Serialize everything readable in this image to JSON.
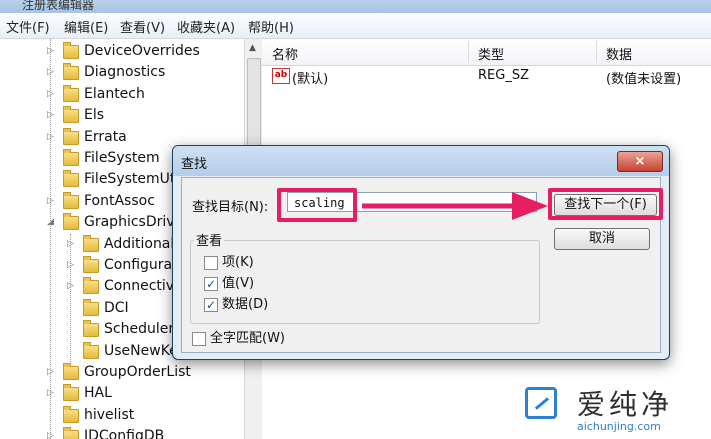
{
  "window": {
    "title": "注册表编辑器"
  },
  "menu": [
    "文件(F)",
    "编辑(E)",
    "查看(V)",
    "收藏夹(A)",
    "帮助(H)"
  ],
  "tree": {
    "items": [
      {
        "label": "DeviceOverrides",
        "level": 1
      },
      {
        "label": "Diagnostics",
        "level": 1
      },
      {
        "label": "Elantech",
        "level": 1
      },
      {
        "label": "Els",
        "level": 1
      },
      {
        "label": "Errata",
        "level": 1
      },
      {
        "label": "FileSystem",
        "level": 1
      },
      {
        "label": "FileSystemUti",
        "level": 1
      },
      {
        "label": "FontAssoc",
        "level": 1
      },
      {
        "label": "GraphicsDrive",
        "level": 1,
        "expanded": true
      },
      {
        "label": "Additional",
        "level": 2
      },
      {
        "label": "Configurat",
        "level": 2,
        "selected": true
      },
      {
        "label": "Connectiv",
        "level": 2
      },
      {
        "label": "DCI",
        "level": 2
      },
      {
        "label": "Scheduler",
        "level": 2
      },
      {
        "label": "UseNewKe",
        "level": 2
      },
      {
        "label": "GroupOrderList",
        "level": 1
      },
      {
        "label": "HAL",
        "level": 1
      },
      {
        "label": "hivelist",
        "level": 1
      },
      {
        "label": "IDConfigDB",
        "level": 1
      }
    ]
  },
  "list": {
    "columns": [
      "名称",
      "类型",
      "数据"
    ],
    "rows": [
      {
        "name": "(默认)",
        "type": "REG_SZ",
        "data": "(数值未设置)",
        "icon": "ab-string-icon"
      }
    ]
  },
  "dialog": {
    "title": "查找",
    "close_label": "×",
    "find_label": "查找目标(N):",
    "find_value": "scaling",
    "find_next_label": "查找下一个(F)",
    "cancel_label": "取消",
    "look_at_title": "查看",
    "options": [
      {
        "label": "项(K)",
        "checked": false
      },
      {
        "label": "值(V)",
        "checked": true
      },
      {
        "label": "数据(D)",
        "checked": true
      }
    ],
    "match_whole": {
      "label": "全字匹配(W)",
      "checked": false
    }
  },
  "annotation": {
    "color": "#e61e64"
  },
  "watermark": {
    "cn": "爱纯净",
    "en": "aichunjing.com"
  }
}
